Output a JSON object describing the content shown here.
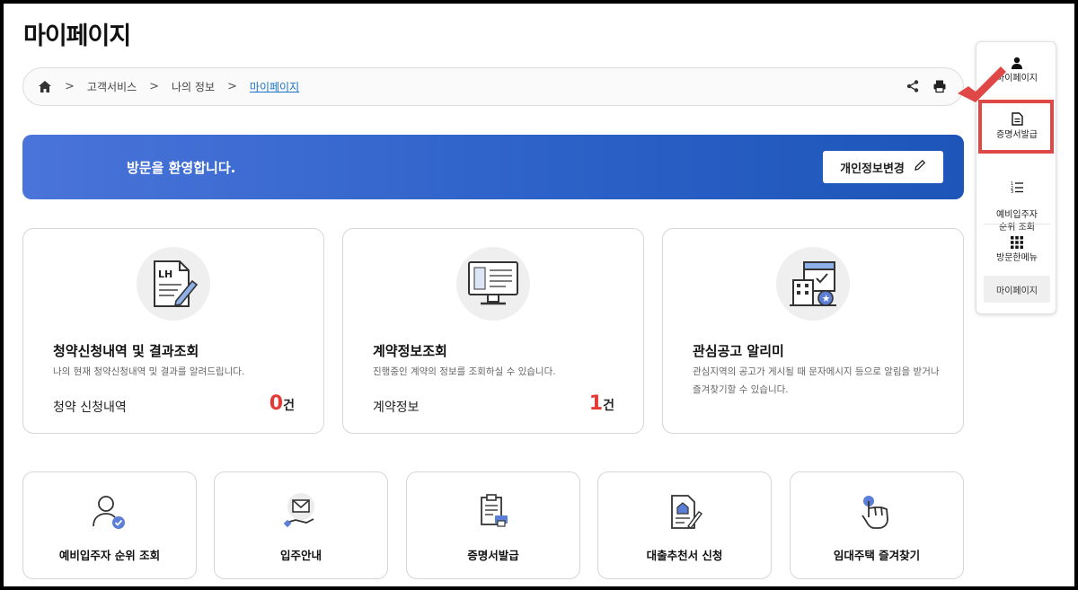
{
  "page": {
    "title": "마이페이지"
  },
  "breadcrumb": {
    "items": [
      "고객서비스",
      "나의 정보"
    ],
    "current": "마이페이지"
  },
  "banner": {
    "welcome": "방문을 환영합니다.",
    "button": "개인정보변경"
  },
  "cards": [
    {
      "title": "청약신청내역 및 결과조회",
      "desc": "나의 현재 청약신청내역 및 결과를 알려드립니다.",
      "label": "청약 신청내역",
      "count": "0",
      "unit": "건"
    },
    {
      "title": "계약정보조회",
      "desc": "진행중인 계약의 정보를 조회하실 수 있습니다.",
      "label": "계약정보",
      "count": "1",
      "unit": "건"
    },
    {
      "title": "관심공고 알리미",
      "desc": "관심지역의 공고가 게시될 때 문자메시지 등으로 알림을 받거나 즐겨찾기할 수 있습니다."
    }
  ],
  "mini_cards": [
    "예비입주자 순위 조회",
    "입주안내",
    "증명서발급",
    "대출추천서 신청",
    "임대주택 즐겨찾기"
  ],
  "quick_menu": {
    "items": [
      "마이페이지",
      "증명서발급",
      "예비입주자\n순위 조회",
      "방문한메뉴"
    ],
    "visited": "마이페이지"
  },
  "colors": {
    "accent": "#2d62c8",
    "count_red": "#e53935",
    "highlight": "#e04848",
    "link": "#1a73c8"
  }
}
